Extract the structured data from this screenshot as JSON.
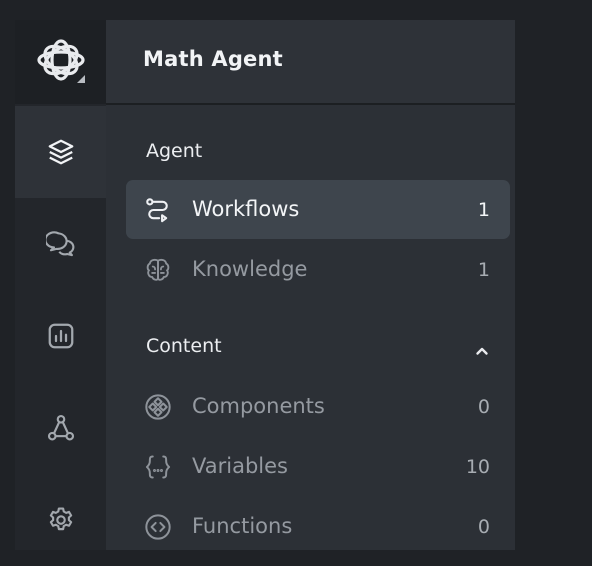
{
  "app": {
    "title": "Math Agent",
    "logo_icon": "flower-logo-icon"
  },
  "rail": {
    "items": [
      {
        "name": "layers",
        "icon": "layers-icon",
        "active": true
      },
      {
        "name": "chat",
        "icon": "chat-bubbles-icon",
        "active": false
      },
      {
        "name": "analytics",
        "icon": "bar-chart-icon",
        "active": false
      },
      {
        "name": "integrations",
        "icon": "graph-nodes-icon",
        "active": false
      },
      {
        "name": "settings",
        "icon": "gear-icon",
        "active": false
      }
    ]
  },
  "sections": {
    "agent": {
      "label": "Agent",
      "items": [
        {
          "label": "Workflows",
          "count": "1",
          "icon": "workflow-route-icon",
          "active": true
        },
        {
          "label": "Knowledge",
          "count": "1",
          "icon": "brain-icon",
          "active": false
        }
      ]
    },
    "content": {
      "label": "Content",
      "expanded": true,
      "toggle_icon": "chevron-up-icon",
      "items": [
        {
          "label": "Components",
          "count": "0",
          "icon": "components-diamond-icon",
          "active": false
        },
        {
          "label": "Variables",
          "count": "10",
          "icon": "variables-braces-icon",
          "active": false
        },
        {
          "label": "Functions",
          "count": "0",
          "icon": "code-circle-icon",
          "active": false
        }
      ]
    }
  },
  "colors": {
    "background": "#1f2226",
    "panel": "#2c3036",
    "active_item": "#3e454d",
    "text_primary": "#f3f5f7",
    "text_muted": "#959aa1"
  }
}
